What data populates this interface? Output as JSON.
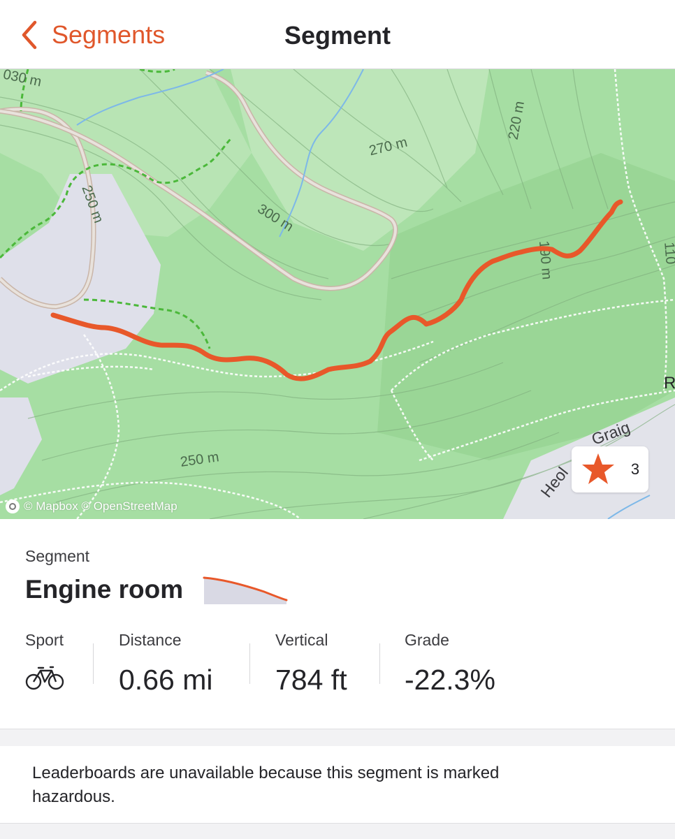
{
  "nav": {
    "back_label": "Segments",
    "title": "Segment"
  },
  "map": {
    "contour_labels": [
      "030 m",
      "250 m",
      "300 m",
      "270 m",
      "220 m",
      "190 m",
      "250 m",
      "110"
    ],
    "street_labels": [
      "Graig",
      "Heol",
      "R"
    ],
    "attribution": "© Mapbox © OpenStreetMap",
    "star_count": "3",
    "route_color": "#e8582a"
  },
  "segment": {
    "kicker": "Segment",
    "name": "Engine room"
  },
  "stats": {
    "sport": {
      "label": "Sport",
      "icon": "bike-icon"
    },
    "distance": {
      "label": "Distance",
      "value": "0.66 mi"
    },
    "vertical": {
      "label": "Vertical",
      "value": "784 ft"
    },
    "grade": {
      "label": "Grade",
      "value": "-22.3%"
    }
  },
  "notice": {
    "text": "Leaderboards are unavailable because this segment is marked hazardous."
  },
  "colors": {
    "accent": "#e0572b",
    "map_green": "#a6dea3",
    "map_light": "#c5e8c1",
    "trail_green": "#4bb83a"
  }
}
